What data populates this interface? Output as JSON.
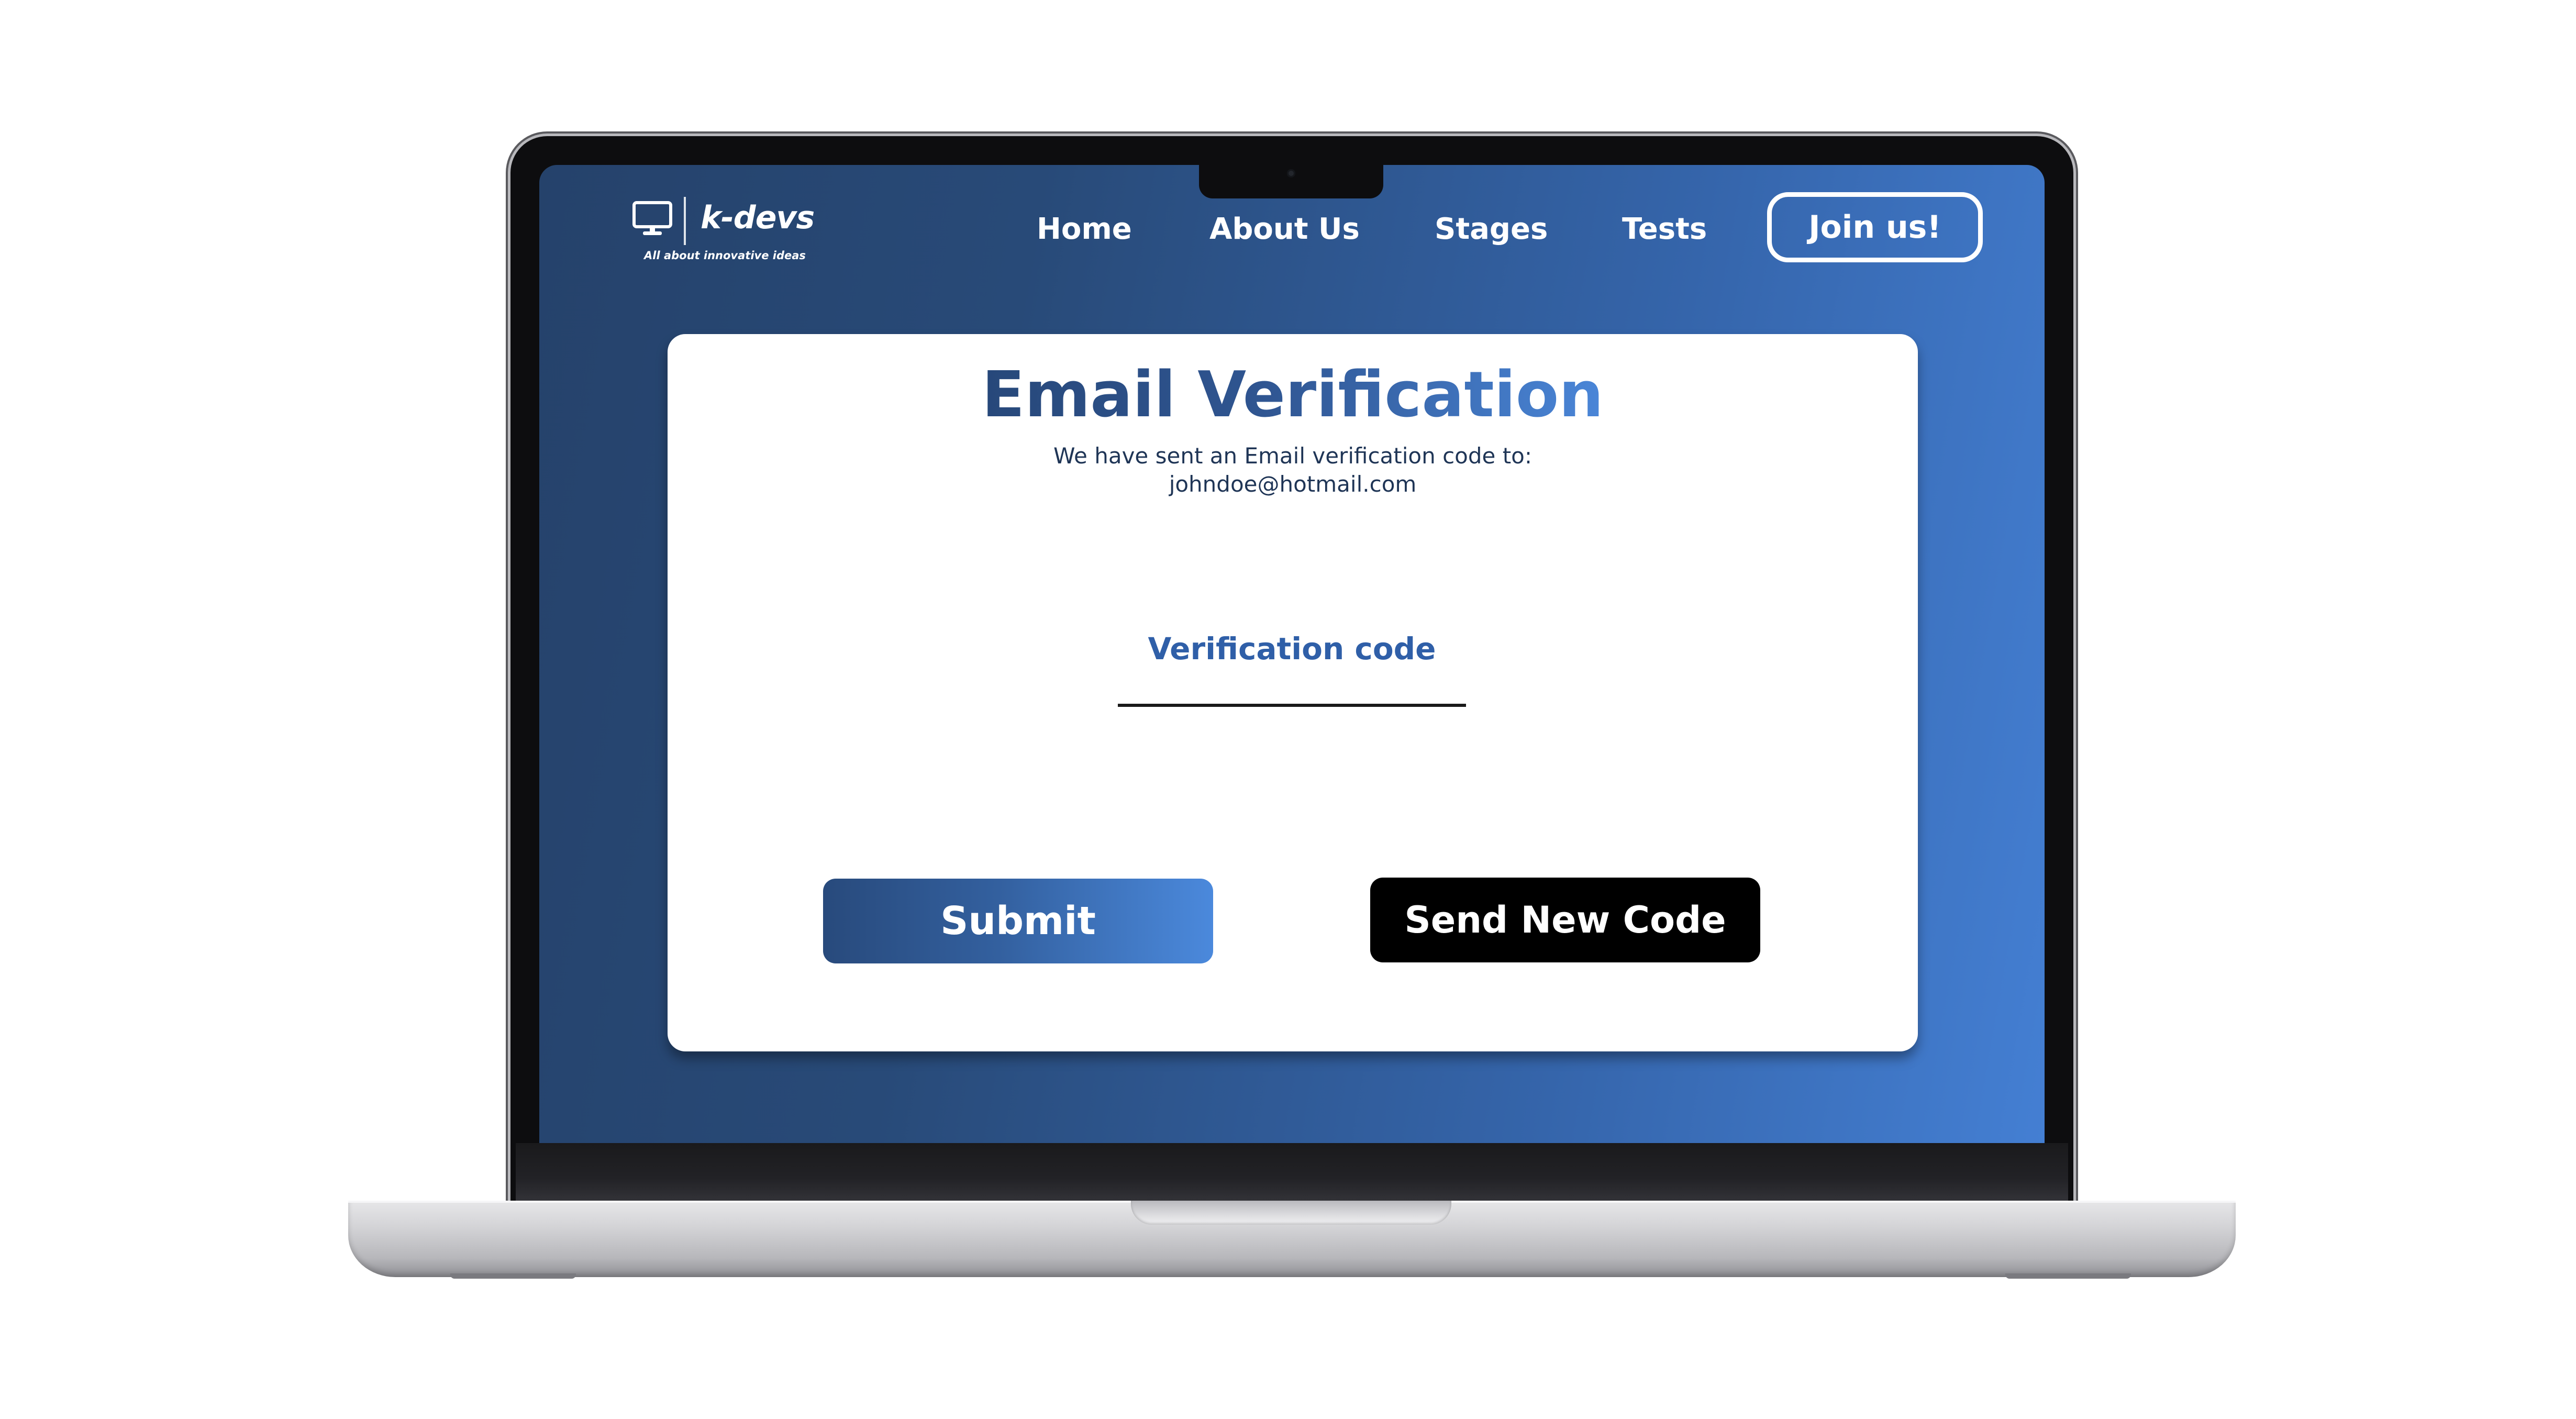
{
  "header": {
    "brand": "k-devs",
    "tagline": "All about innovative ideas",
    "logo_icon": "monitor-icon",
    "nav": {
      "home": "Home",
      "about": "About Us",
      "stages": "Stages",
      "tests": "Tests"
    },
    "join_label": "Join us!"
  },
  "verification": {
    "title": "Email Verification",
    "message": "We have sent an Email verification code to:",
    "email": "johndoe@hotmail.com",
    "code_label": "Verification code",
    "code_value": "",
    "submit_label": "Submit",
    "resend_label": "Send New Code"
  },
  "colors": {
    "background_gradient_start": "#25426b",
    "background_gradient_end": "#447fd3",
    "title_gradient_start": "#27487a",
    "title_gradient_end": "#4a86d8",
    "resend_button": "#000000"
  }
}
